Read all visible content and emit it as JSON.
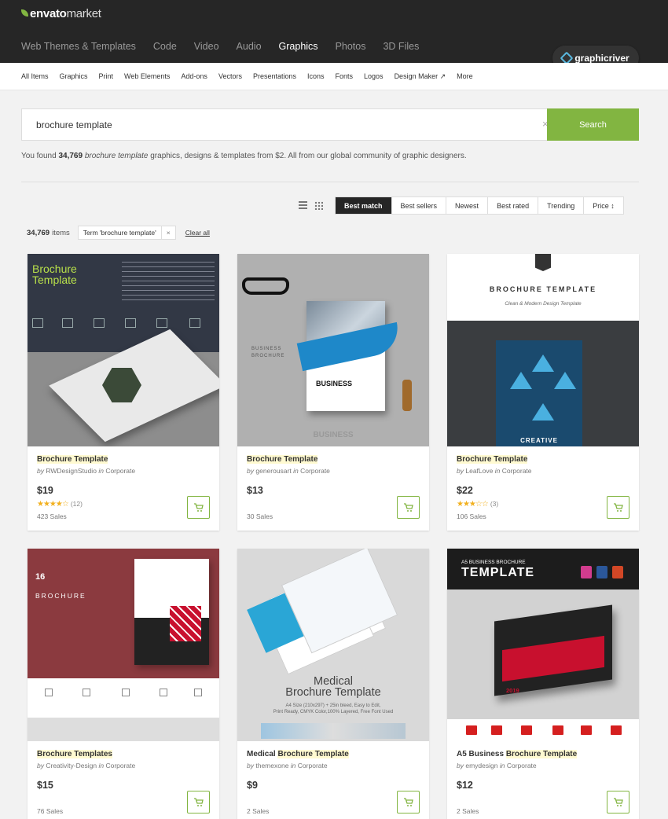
{
  "header": {
    "logo": "envato",
    "logo_suffix": "market",
    "nav": [
      "Web Themes & Templates",
      "Code",
      "Video",
      "Audio",
      "Graphics",
      "Photos",
      "3D Files"
    ],
    "active_nav": "Graphics",
    "badge": "graphicriver"
  },
  "subnav": [
    "All Items",
    "Graphics",
    "Print",
    "Web Elements",
    "Add-ons",
    "Vectors",
    "Presentations",
    "Icons",
    "Fonts",
    "Logos",
    "Design Maker ↗",
    "More"
  ],
  "search": {
    "value": "brochure template",
    "clear": "×",
    "button": "Search"
  },
  "found": {
    "prefix": "You found",
    "count": "34,769",
    "query": "brochure template",
    "suffix": "graphics, designs & templates from $2. All from our global community of graphic designers."
  },
  "sort": {
    "options": [
      "Best match",
      "Best sellers",
      "Newest",
      "Best rated",
      "Trending",
      "Price ↕"
    ],
    "selected": "Best match"
  },
  "results": {
    "count": "34,769",
    "items_label": "items",
    "tag": "Term 'brochure template'",
    "tag_close": "×",
    "clear_all": "Clear all"
  },
  "cards": [
    {
      "title_pre": "",
      "title_mark": "Brochure Template",
      "title_post": "",
      "by": "by",
      "author": "RWDesignStudio",
      "in": "in",
      "category": "Corporate",
      "price": "$19",
      "stars": "★★★★☆",
      "rating_count": "(12)",
      "sales": "423 Sales",
      "thumb_heading_1": "Brochure",
      "thumb_heading_2": "Template"
    },
    {
      "title_pre": "",
      "title_mark": "Brochure Template",
      "title_post": "",
      "by": "by",
      "author": "generousart",
      "in": "in",
      "category": "Corporate",
      "price": "$13",
      "stars": "",
      "rating_count": "",
      "sales": "30 Sales",
      "thumb_heading_1": "BUSINESS",
      "thumb_heading_2": "BUSINESS"
    },
    {
      "title_pre": "",
      "title_mark": "Brochure Template",
      "title_post": "",
      "by": "by",
      "author": "LeafLove",
      "in": "in",
      "category": "Corporate",
      "price": "$22",
      "stars": "★★★☆☆",
      "rating_count": "(3)",
      "sales": "106 Sales",
      "thumb_heading_1": "BROCHURE TEMPLATE",
      "thumb_heading_2": "CREATIVE"
    },
    {
      "title_pre": "",
      "title_mark": "Brochure Templates",
      "title_post": "",
      "by": "by",
      "author": "Creativity-Design",
      "in": "in",
      "category": "Corporate",
      "price": "$15",
      "stars": "",
      "rating_count": "",
      "sales": "76 Sales",
      "thumb_heading_1": "16",
      "thumb_heading_2": "BROCHURE"
    },
    {
      "title_pre": "Medical ",
      "title_mark": "Brochure Template",
      "title_post": "",
      "by": "by",
      "author": "themexone",
      "in": "in",
      "category": "Corporate",
      "price": "$9",
      "stars": "",
      "rating_count": "",
      "sales": "2 Sales",
      "thumb_heading_1": "Medical",
      "thumb_heading_2": "Brochure Template"
    },
    {
      "title_pre": "A5 Business ",
      "title_mark": "Brochure Template",
      "title_post": "",
      "by": "by",
      "author": "emydesign",
      "in": "in",
      "category": "Corporate",
      "price": "$12",
      "stars": "",
      "rating_count": "",
      "sales": "2 Sales",
      "thumb_heading_1": "A5 BUSINESS BROCHURE",
      "thumb_heading_2": "TEMPLATE"
    }
  ],
  "colors": {
    "brand_green": "#82b541",
    "header_bg": "#262626",
    "highlight": "#fffad1",
    "star": "#f2b01e"
  }
}
